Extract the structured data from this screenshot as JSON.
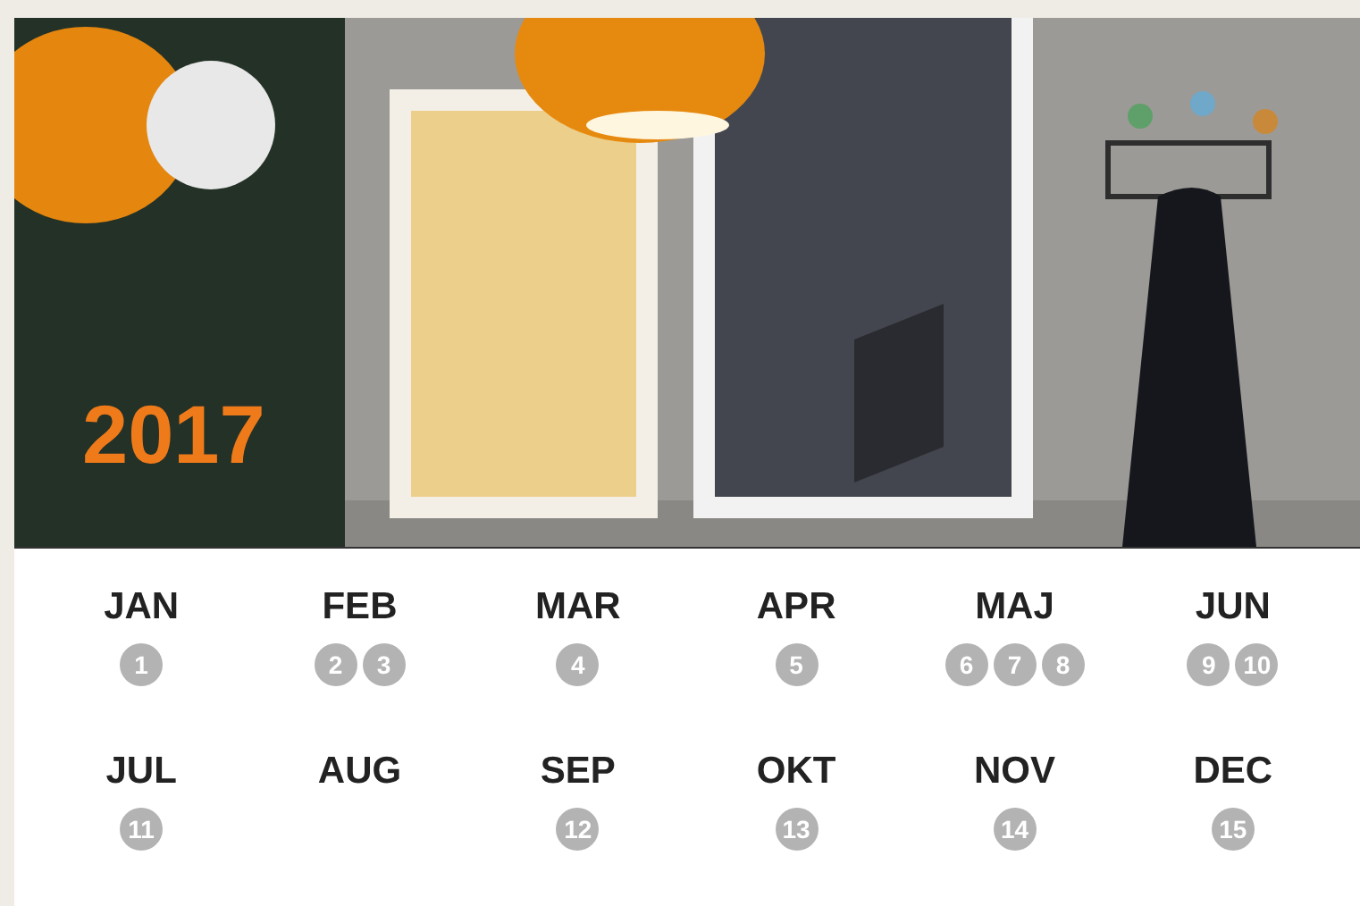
{
  "hero": {
    "kind": "picture",
    "year": "2017"
  },
  "months": [
    {
      "name": "JAN",
      "numbers": [
        "1"
      ]
    },
    {
      "name": "FEB",
      "numbers": [
        "2",
        "3"
      ]
    },
    {
      "name": "MAR",
      "numbers": [
        "4"
      ]
    },
    {
      "name": "APR",
      "numbers": [
        "5"
      ]
    },
    {
      "name": "MAJ",
      "numbers": [
        "6",
        "7",
        "8"
      ]
    },
    {
      "name": "JUN",
      "numbers": [
        "9",
        "10"
      ]
    },
    {
      "name": "JUL",
      "numbers": [
        "11"
      ]
    },
    {
      "name": "AUG"
    },
    {
      "name": "SEP",
      "numbers": [
        "12"
      ]
    },
    {
      "name": "OKT",
      "numbers": [
        "13"
      ]
    },
    {
      "name": "NOV",
      "numbers": [
        "14"
      ]
    },
    {
      "name": "DEC",
      "numbers": [
        "15"
      ]
    }
  ]
}
